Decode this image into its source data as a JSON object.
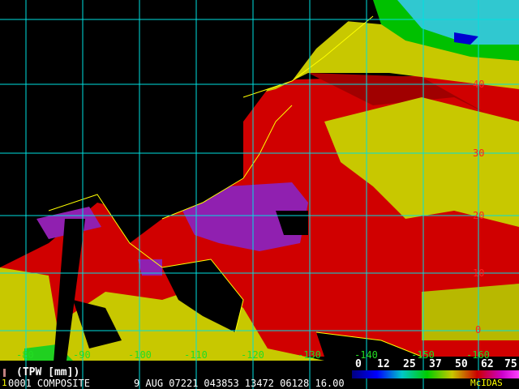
{
  "product_title": "(TPW [mm])",
  "frame_number": "1",
  "footer": {
    "id": "0001",
    "name": "COMPOSITE",
    "date": "9 AUG 07221",
    "time": "043853",
    "fields": "13472 06128 16.00"
  },
  "brand": "McIDAS",
  "longitude_labels": [
    "-80",
    "-90",
    "-100",
    "-110",
    "-120",
    "-130",
    "-140",
    "-150",
    "-160"
  ],
  "latitude_labels": [
    "40",
    "30",
    "20",
    "10",
    "0"
  ],
  "color_scale": {
    "labels": [
      "0",
      "12",
      "25",
      "37",
      "50",
      "62",
      "75"
    ],
    "colors": [
      "#000080",
      "#0000ff",
      "#00c8c8",
      "#00cc00",
      "#c8c800",
      "#cc0000",
      "#cc00cc"
    ]
  },
  "colors": {
    "grid": "#00e0e0",
    "lon_label": "#22dd22",
    "lat_label": "#ff2020",
    "coast": "#ffff00"
  }
}
